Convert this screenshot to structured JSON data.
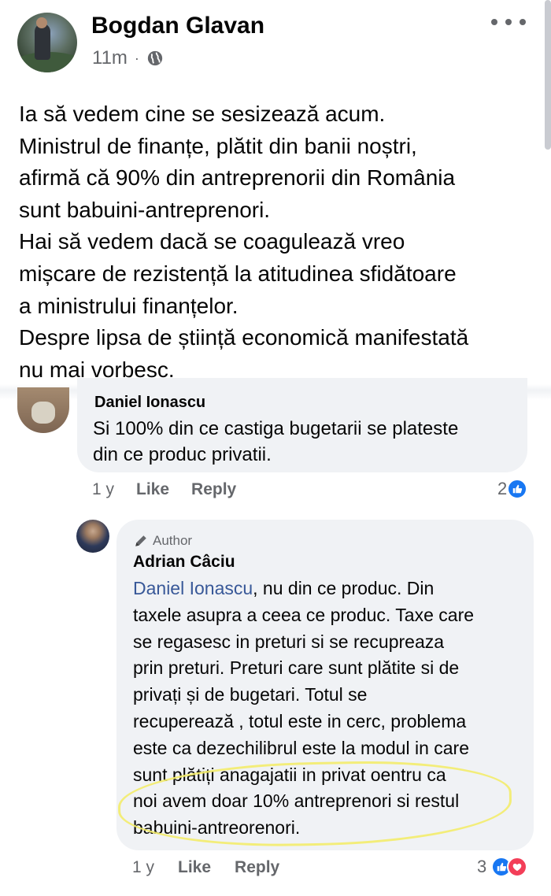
{
  "post": {
    "author": "Bogdan Glavan",
    "time": "11m",
    "separator": "·",
    "lines": [
      "Ia să vedem cine se sesizează acum.",
      "Ministrul de finanțe, plătit din banii noștri,",
      "afirmă că 90% din antreprenorii din România",
      "sunt babuini-antreprenori.",
      "Hai să vedem dacă se coagulează vreo",
      "mișcare de rezistență la atitudinea sfidătoare",
      "a ministrului finanțelor.",
      "Despre lipsa de știință economică manifestată",
      "nu mai vorbesc."
    ]
  },
  "comment1": {
    "author": "Daniel Ionascu",
    "lines": [
      "Si 100% din ce castiga bugetarii se plateste",
      "din ce produc privatii."
    ],
    "time": "1 y",
    "like": "Like",
    "reply": "Reply",
    "reaction_count": "2"
  },
  "comment2": {
    "badge": "Author",
    "author": "Adrian Câciu",
    "mention": "Daniel Ionascu",
    "first_line_rest": ", nu din ce produc. Din",
    "lines": [
      "taxele asupra a ceea ce produc. Taxe care",
      "se regasesc in preturi si se recupreaza",
      "prin preturi. Preturi care sunt plătite si de",
      "privați și de bugetari. Totul se",
      "recuperează , totul este in cerc, problema",
      "este ca dezechilibrul este la modul in care",
      "sunt plătiți anagajatii in privat oentru ca",
      "noi avem doar 10% antreprenori si restul",
      "babuini-antreorenori."
    ],
    "time": "1 y",
    "like": "Like",
    "reply": "Reply",
    "reaction_count": "3"
  },
  "icons": {
    "privacy": "globe-icon",
    "more": "more-options-icon",
    "badge": "pen-icon",
    "reaction_like": "like-icon",
    "reaction_love": "love-icon"
  },
  "colors": {
    "like": "#1877f2",
    "love": "#f33e58",
    "mention": "#385898",
    "highlight": "#f3ec6b",
    "bubble": "#f0f2f5"
  }
}
